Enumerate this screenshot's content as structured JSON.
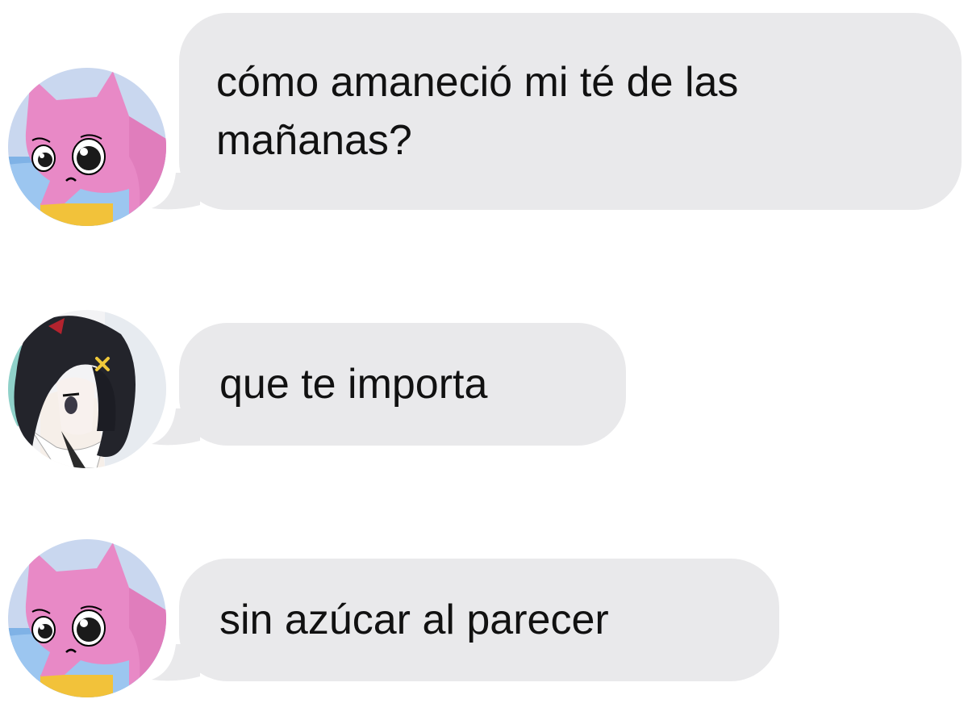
{
  "conversation": {
    "messages": [
      {
        "sender_avatar": "pink-cat-avatar",
        "text": "cómo amaneció mi té de las mañanas?"
      },
      {
        "sender_avatar": "dark-haired-girl-avatar",
        "text": "que te importa"
      },
      {
        "sender_avatar": "pink-cat-avatar",
        "text": "sin azúcar al parecer"
      }
    ]
  },
  "colors": {
    "bubble_background": "#e9e9eb",
    "text": "#111111",
    "page_background": "#ffffff"
  }
}
